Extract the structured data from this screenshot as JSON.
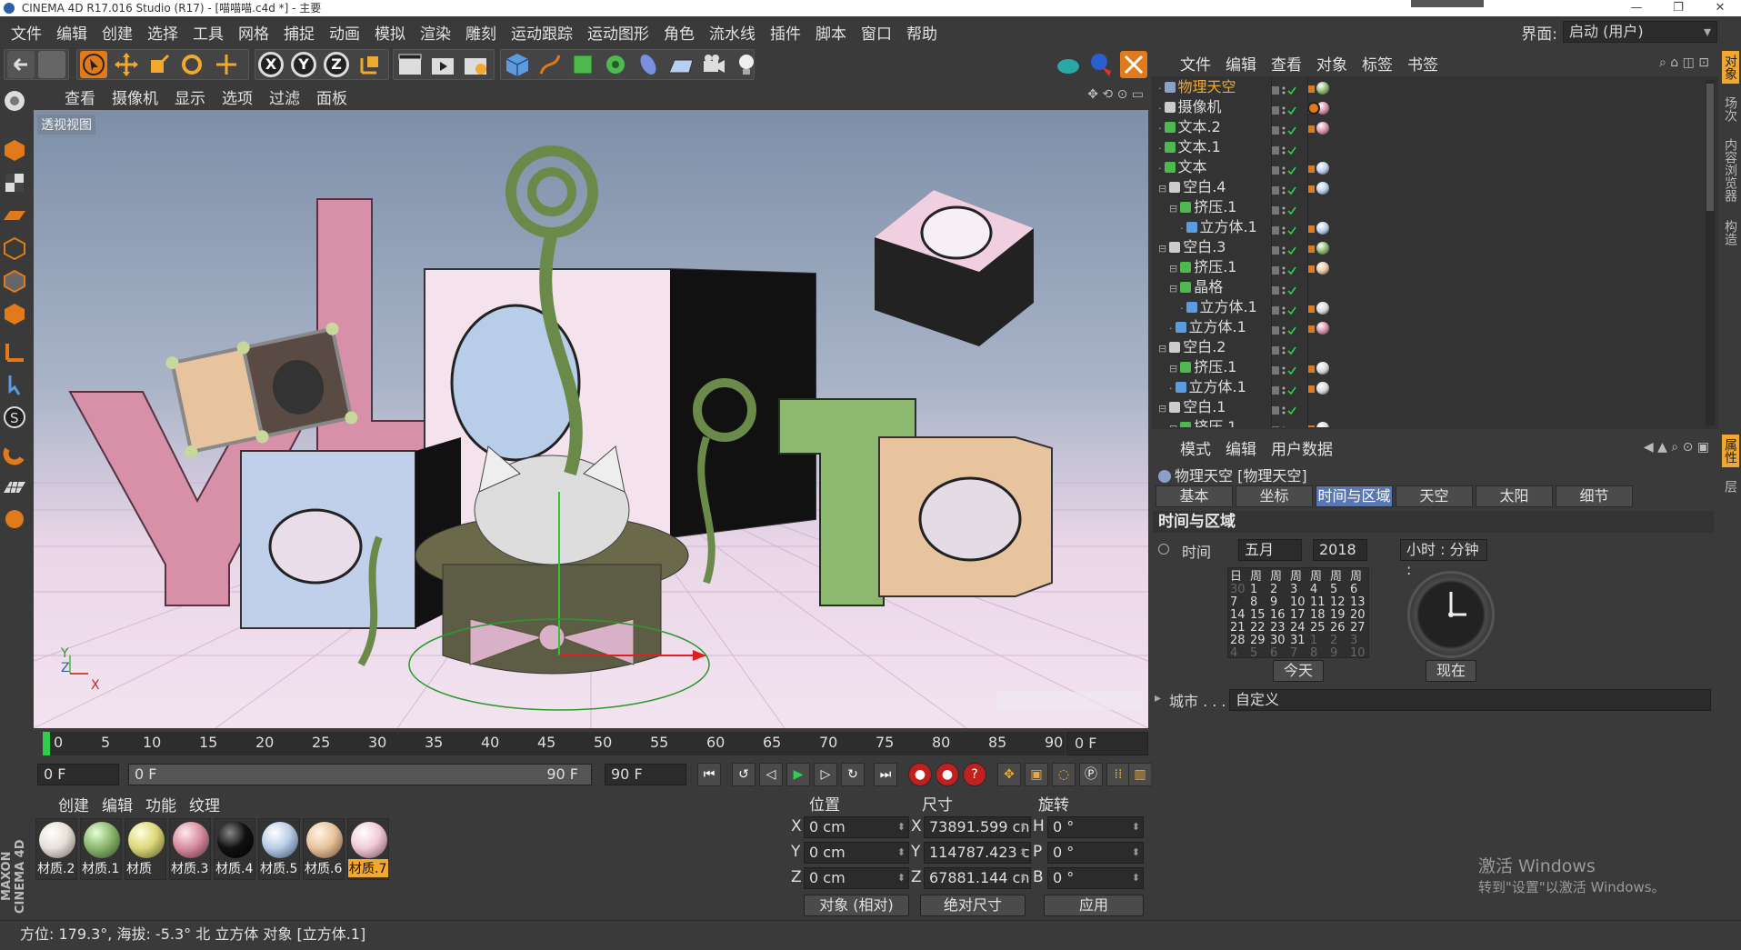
{
  "window": {
    "title": "CINEMA 4D R17.016 Studio (R17) - [喵喵喵.c4d *] - 主要",
    "controls": [
      "—",
      "❐",
      "✕"
    ]
  },
  "menu": [
    "文件",
    "编辑",
    "创建",
    "选择",
    "工具",
    "网格",
    "捕捉",
    "动画",
    "模拟",
    "渲染",
    "雕刻",
    "运动跟踪",
    "运动图形",
    "角色",
    "流水线",
    "插件",
    "脚本",
    "窗口",
    "帮助"
  ],
  "layout": {
    "label": "界面:",
    "value": "启动 (用户)"
  },
  "toolbar": {
    "axis_x": "X",
    "axis_y": "Y",
    "axis_z": "Z"
  },
  "viewport": {
    "menu": [
      "查看",
      "摄像机",
      "显示",
      "选项",
      "过滤",
      "面板"
    ],
    "label": "透视视图",
    "axis_x": "X",
    "axis_y": "Y",
    "axis_z": "Z"
  },
  "timeline": {
    "ticks": [
      "0",
      "5",
      "10",
      "15",
      "20",
      "25",
      "30",
      "35",
      "40",
      "45",
      "50",
      "55",
      "60",
      "65",
      "70",
      "75",
      "80",
      "85",
      "90"
    ],
    "current_frame": "0 F"
  },
  "transport": {
    "start": "0 F",
    "range_start": "0 F",
    "range_end": "90 F",
    "end": "90 F"
  },
  "materials": {
    "menu": [
      "创建",
      "编辑",
      "功能",
      "纹理"
    ],
    "items": [
      {
        "label": "材质.2",
        "color": "#e8e0d8"
      },
      {
        "label": "材质.1",
        "color": "#8cb870"
      },
      {
        "label": "材质",
        "color": "#dcd87a"
      },
      {
        "label": "材质.3",
        "color": "#d88ea0"
      },
      {
        "label": "材质.4",
        "color": "#111111"
      },
      {
        "label": "材质.5",
        "color": "#b8cde8"
      },
      {
        "label": "材质.6",
        "color": "#e8c49e"
      },
      {
        "label": "材质.7",
        "color": "#f2cad8",
        "selected": true
      }
    ]
  },
  "coordinates": {
    "headers": {
      "position": "位置",
      "size": "尺寸",
      "rotation": "旋转"
    },
    "rows": [
      {
        "axis": "X",
        "pos": "0 cm",
        "size_axis": "X",
        "size": "73891.599 cn",
        "rot_axis": "H",
        "rot": "0 °"
      },
      {
        "axis": "Y",
        "pos": "0 cm",
        "size_axis": "Y",
        "size": "114787.423 c",
        "rot_axis": "P",
        "rot": "0 °"
      },
      {
        "axis": "Z",
        "pos": "0 cm",
        "size_axis": "Z",
        "size": "67881.144 cn",
        "rot_axis": "B",
        "rot": "0 °"
      }
    ],
    "mode": "对象 (相对)",
    "size_mode": "绝对尺寸",
    "apply": "应用"
  },
  "status": "方位: 179.3°, 海拔: -5.3°  北   立方体 对象 [立方体.1]",
  "objects": {
    "menu": [
      "文件",
      "编辑",
      "查看",
      "对象",
      "标签",
      "书签"
    ],
    "rows": [
      {
        "indent": 0,
        "name": "物理天空",
        "highlight": true,
        "icon": "#8aa0c8"
      },
      {
        "indent": 0,
        "name": "摄像机",
        "icon": "#cccccc"
      },
      {
        "indent": 0,
        "name": "文本.2",
        "icon": "#4fb84f"
      },
      {
        "indent": 0,
        "name": "文本.1",
        "icon": "#4fb84f"
      },
      {
        "indent": 0,
        "name": "文本",
        "icon": "#4fb84f"
      },
      {
        "indent": 0,
        "name": "空白.4",
        "icon": "#cccccc"
      },
      {
        "indent": 1,
        "name": "挤压.1",
        "icon": "#4fb84f"
      },
      {
        "indent": 2,
        "name": "立方体.1",
        "icon": "#5b9be0"
      },
      {
        "indent": 0,
        "name": "空白.3",
        "icon": "#cccccc"
      },
      {
        "indent": 1,
        "name": "挤压.1",
        "icon": "#4fb84f"
      },
      {
        "indent": 1,
        "name": "晶格",
        "icon": "#4fb84f"
      },
      {
        "indent": 2,
        "name": "立方体.1",
        "icon": "#5b9be0"
      },
      {
        "indent": 1,
        "name": "立方体.1",
        "icon": "#5b9be0"
      },
      {
        "indent": 0,
        "name": "空白.2",
        "icon": "#cccccc"
      },
      {
        "indent": 1,
        "name": "挤压.1",
        "icon": "#4fb84f"
      },
      {
        "indent": 1,
        "name": "立方体.1",
        "icon": "#5b9be0"
      },
      {
        "indent": 0,
        "name": "空白.1",
        "icon": "#cccccc"
      },
      {
        "indent": 1,
        "name": "挤压.1",
        "icon": "#4fb84f"
      }
    ]
  },
  "attributes": {
    "menu": [
      "模式",
      "编辑",
      "用户数据"
    ],
    "title": "物理天空 [物理天空]",
    "tabs": [
      "基本",
      "坐标",
      "时间与区域",
      "天空",
      "太阳",
      "细节"
    ],
    "active_tab": "时间与区域",
    "section": "时间与区域",
    "time_label": "时间",
    "month": "五月",
    "year": "2018",
    "time_format": "小时 : 分钟 :",
    "today": "今天",
    "now": "现在",
    "city_label": "城市 . . . .",
    "city_value": "自定义"
  },
  "watermark": {
    "line1": "激活 Windows",
    "line2": "转到\"设置\"以激活 Windows。"
  },
  "right_tabs": [
    "对象",
    "场次",
    "内容浏览器",
    "构造"
  ],
  "right_tabs2": [
    "属性",
    "层"
  ],
  "colors": {
    "accent": "#f0a830",
    "selected_tab": "#5a77b0",
    "panel": "#3a3a3a"
  }
}
